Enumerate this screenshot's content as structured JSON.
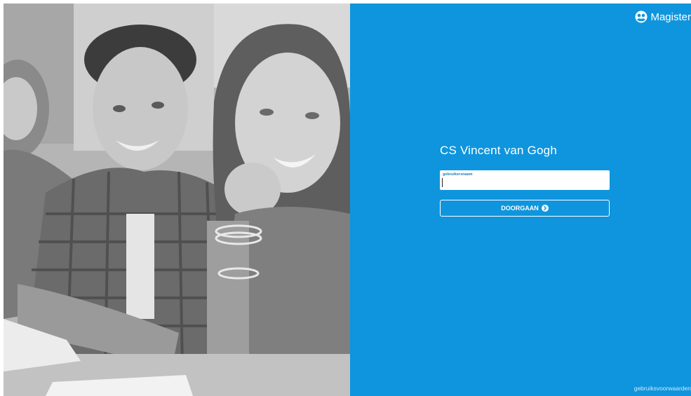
{
  "brand": {
    "name": "Magister",
    "logo_icon": "magister-logo-icon"
  },
  "login": {
    "school_name": "CS Vincent van Gogh",
    "username_label": "gebruikersnaam",
    "username_value": "",
    "continue_label": "DOORGAAN",
    "continue_icon": "arrow-right-circle-icon"
  },
  "footer": {
    "terms_link": "gebruiksvoorwaarden"
  },
  "colors": {
    "panel_background": "#0f95dd",
    "label_color": "#1a7fc0",
    "text_white": "#ffffff"
  }
}
